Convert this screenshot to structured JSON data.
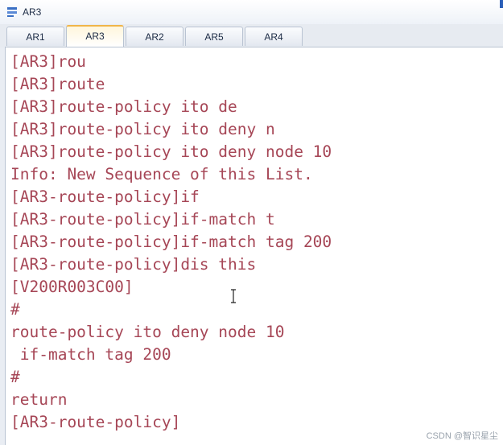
{
  "window": {
    "title": "AR3"
  },
  "tabs": [
    {
      "label": "AR1",
      "active": false
    },
    {
      "label": "AR3",
      "active": true
    },
    {
      "label": "AR2",
      "active": false
    },
    {
      "label": "AR5",
      "active": false
    },
    {
      "label": "AR4",
      "active": false
    }
  ],
  "console": {
    "text_color": "#a64656",
    "lines": [
      "[AR3]rou",
      "[AR3]route",
      "[AR3]route-policy ito de",
      "[AR3]route-policy ito deny n",
      "[AR3]route-policy ito deny node 10",
      "Info: New Sequence of this List.",
      "[AR3-route-policy]if",
      "[AR3-route-policy]if-match t",
      "[AR3-route-policy]if-match tag 200",
      "[AR3-route-policy]dis this",
      "[V200R003C00]",
      "#",
      "route-policy ito deny node 10",
      " if-match tag 200",
      "#",
      "return",
      "[AR3-route-policy]"
    ]
  },
  "watermark": "CSDN @智识星尘",
  "colors": {
    "active_tab_accent": "#f0b54a",
    "window_bg": "#e9edf3"
  }
}
